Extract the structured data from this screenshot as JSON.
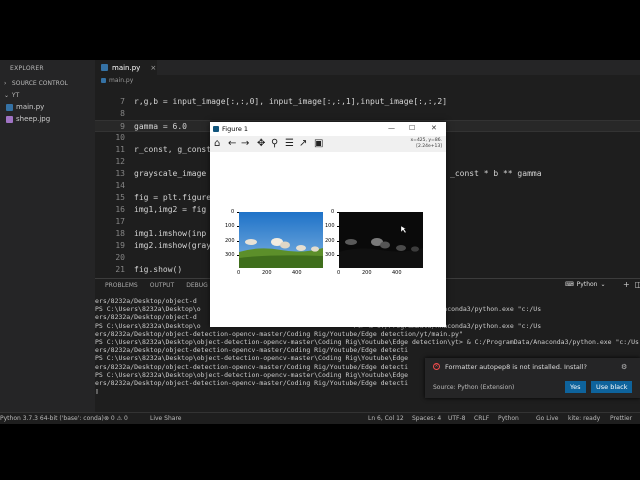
{
  "sidebar": {
    "title": "EXPLORER",
    "source_control": "SOURCE CONTROL",
    "folder": "YT",
    "files": [
      {
        "name": "main.py",
        "icon": "python-file-icon"
      },
      {
        "name": "sheep.jpg",
        "icon": "image-file-icon"
      }
    ]
  },
  "editor": {
    "tab_label": "main.py",
    "tab_close": "×",
    "breadcrumb": "main.py",
    "lines": [
      {
        "num": "7",
        "text": "r,g,b = input_image[:,:,0], input_image[:,:,1],input_image[:,:,2]"
      },
      {
        "num": "8",
        "text": ""
      },
      {
        "num": "9",
        "text": "gamma = 6.0"
      },
      {
        "num": "10",
        "text": ""
      },
      {
        "num": "11",
        "text": "r_const, g_const"
      },
      {
        "num": "12",
        "text": ""
      },
      {
        "num": "13",
        "text": "grayscale_image"
      },
      {
        "num": "14",
        "text": ""
      },
      {
        "num": "15",
        "text": "fig = plt.figure"
      },
      {
        "num": "16",
        "text": "img1,img2 = fig"
      },
      {
        "num": "17",
        "text": ""
      },
      {
        "num": "18",
        "text": "img1.imshow(inp"
      },
      {
        "num": "19",
        "text": "img2.imshow(gray"
      },
      {
        "num": "20",
        "text": ""
      },
      {
        "num": "21",
        "text": "fig.show()"
      }
    ],
    "line13_tail": "_const * b ** gamma"
  },
  "figure": {
    "title": "Figure 1",
    "coords_line1": "x=425, y=86.",
    "coords_line2": "[2.24e+13]",
    "left_yticks": [
      "0",
      "100",
      "200",
      "300"
    ],
    "left_xticks": [
      "0",
      "200",
      "400"
    ],
    "right_yticks": [
      "0",
      "100",
      "200",
      "300"
    ],
    "right_xticks": [
      "0",
      "200",
      "400"
    ]
  },
  "panel": {
    "tabs": [
      "PROBLEMS",
      "OUTPUT",
      "DEBUG C"
    ],
    "terminal_selector": "Python",
    "terminal": [
      "ers/8232a/Desktop/object-d                                       t/main.py\"",
      "PS C:\\Users\\8232a\\Desktop\\o                                       rt> & C:/ProgramData/Anaconda3/python.exe \"c:/Us",
      "ers/8232a/Desktop/object-d                                       t/main.py\"",
      "PS C:\\Users\\8232a\\Desktop\\o                                       rt> & C:/ProgramData/Anaconda3/python.exe \"c:/Us",
      "ers/8232a/Desktop/object-detection-opencv-master/Coding Rig/Youtube/Edge detection/yt/main.py\"",
      "PS C:\\Users\\8232a\\Desktop\\object-detection-opencv-master\\Coding Rig\\Youtube\\Edge detection\\yt> & C:/ProgramData/Anaconda3/python.exe \"c:/Us",
      "ers/8232a/Desktop/object-detection-opencv-master/Coding Rig/Youtube/Edge detecti",
      "PS C:\\Users\\8232a\\Desktop\\object-detection-opencv-master\\Coding Rig\\Youtube\\Edge",
      "ers/8232a/Desktop/object-detection-opencv-master/Coding Rig/Youtube/Edge detecti",
      "PS C:\\Users\\8232a\\Desktop\\object-detection-opencv-master\\Coding Rig\\Youtube\\Edge",
      "ers/8232a/Desktop/object-detection-opencv-master/Coding Rig/Youtube/Edge detecti",
      "▯"
    ]
  },
  "notification": {
    "message": "Formatter autopep8 is not installed. Install?",
    "source": "Source: Python (Extension)",
    "yes_label": "Yes",
    "black_label": "Use black"
  },
  "statusbar": {
    "interpreter": "Python 3.7.3 64-bit ('base': conda)",
    "errors": "⊗ 0 ⚠ 0",
    "live_share": "Live Share",
    "position": "Ln 6, Col 12",
    "spaces": "Spaces: 4",
    "encoding": "UTF-8",
    "eol": "CRLF",
    "language": "Python",
    "go_live": "Go Live",
    "kite": "kite: ready",
    "prettier": "Prettier"
  }
}
